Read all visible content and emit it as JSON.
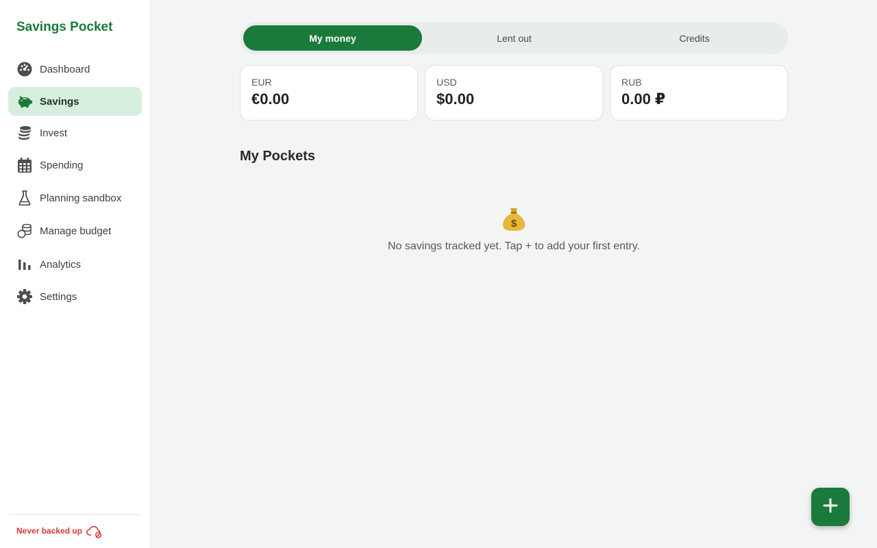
{
  "app": {
    "title": "Savings Pocket"
  },
  "sidebar": {
    "items": [
      {
        "label": "Dashboard",
        "icon": "dashboard-icon"
      },
      {
        "label": "Savings",
        "icon": "piggy-bank-icon",
        "active": true
      },
      {
        "label": "Invest",
        "icon": "coins-stack-icon"
      },
      {
        "label": "Spending",
        "icon": "calendar-icon"
      },
      {
        "label": "Planning sandbox",
        "icon": "flask-icon"
      },
      {
        "label": "Manage budget",
        "icon": "coins-icon"
      },
      {
        "label": "Analytics",
        "icon": "bar-chart-icon"
      },
      {
        "label": "Settings",
        "icon": "gear-icon"
      }
    ],
    "backup_status": "Never backed up",
    "backup_icon": "cloud-off-icon"
  },
  "tabs": [
    {
      "label": "My money",
      "active": true
    },
    {
      "label": "Lent out"
    },
    {
      "label": "Credits"
    }
  ],
  "balances": [
    {
      "currency": "EUR",
      "value": "€0.00"
    },
    {
      "currency": "USD",
      "value": "$0.00"
    },
    {
      "currency": "RUB",
      "value": "0.00 ₽"
    }
  ],
  "pockets": {
    "title": "My Pockets",
    "empty_icon": "money-bag-icon",
    "empty_message": "No savings tracked yet. Tap + to add your first entry."
  },
  "fab": {
    "icon": "plus-icon"
  },
  "colors": {
    "accent": "#1a7a3c",
    "active_bg": "#d6eedd",
    "warning": "#d9383a",
    "page_bg": "#f3f5f4"
  }
}
